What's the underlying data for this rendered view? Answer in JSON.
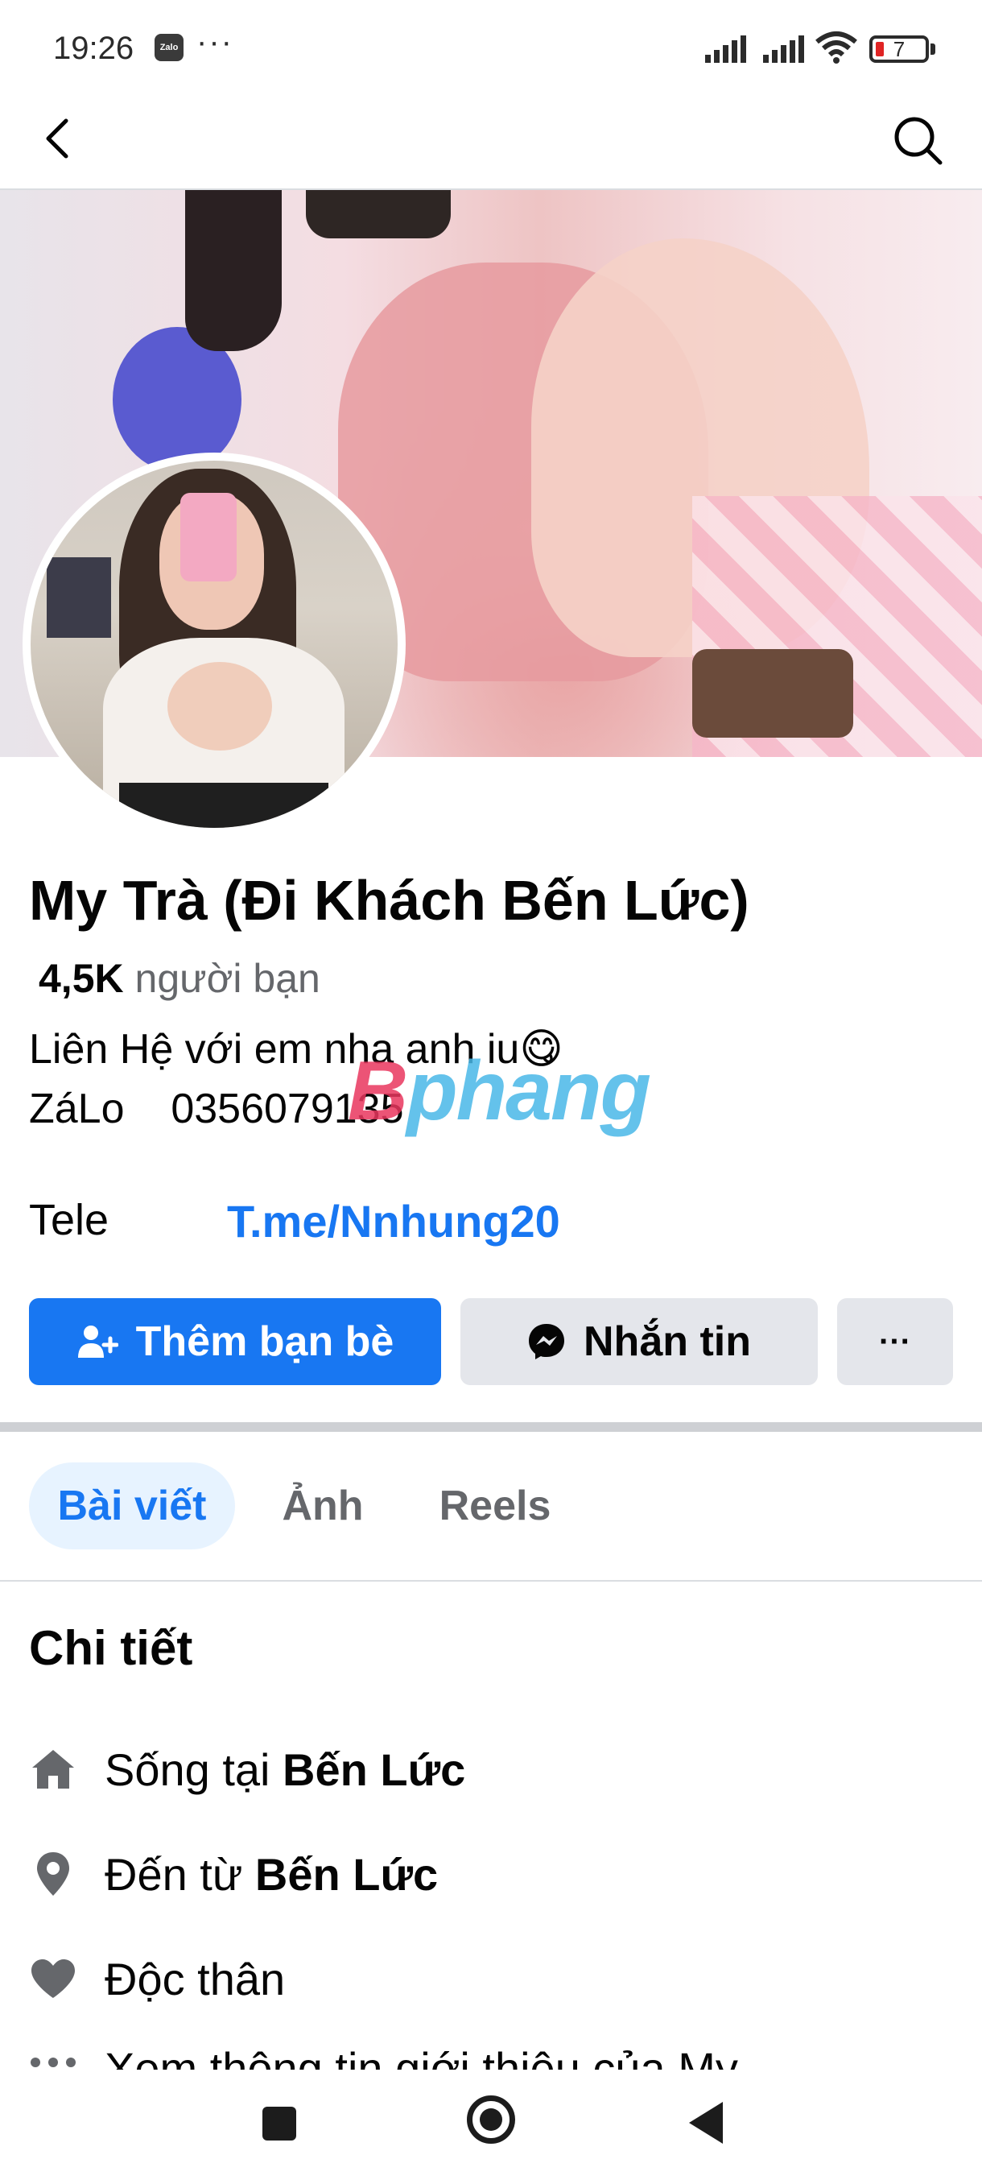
{
  "status_bar": {
    "time": "19:26",
    "notification_app": "Zalo",
    "more_dots": "···",
    "battery_level": "7"
  },
  "nav": {
    "back_icon": "chevron-left-icon",
    "search_icon": "search-icon"
  },
  "profile": {
    "name": "My Trà (Đi Khách Bến Lức)",
    "friends_count": "4,5K",
    "friends_label": " người bạn",
    "bio": "Liên Hệ với em nha anh iu😋\nZáLo    0356079135",
    "watermark": "Bphang",
    "tele_label": "Tele",
    "tele_link": "T.me/Nnhung20"
  },
  "actions": {
    "add_friend": "Thêm bạn bè",
    "message": "Nhắn tin",
    "more": "···"
  },
  "tabs": [
    {
      "label": "Bài viết",
      "active": true
    },
    {
      "label": "Ảnh",
      "active": false
    },
    {
      "label": "Reels",
      "active": false
    }
  ],
  "details": {
    "title": "Chi tiết",
    "lives_prefix": "Sống tại ",
    "lives_place": "Bến Lức",
    "from_prefix": "Đến từ ",
    "from_place": "Bến Lức",
    "relationship": "Độc thân",
    "see_more": "Xem thông tin giới thiệu của My"
  },
  "colors": {
    "accent": "#1877f2",
    "button_gray": "#e4e6eb",
    "secondary_text": "#65676b",
    "tab_active_bg": "#e7f3ff"
  }
}
